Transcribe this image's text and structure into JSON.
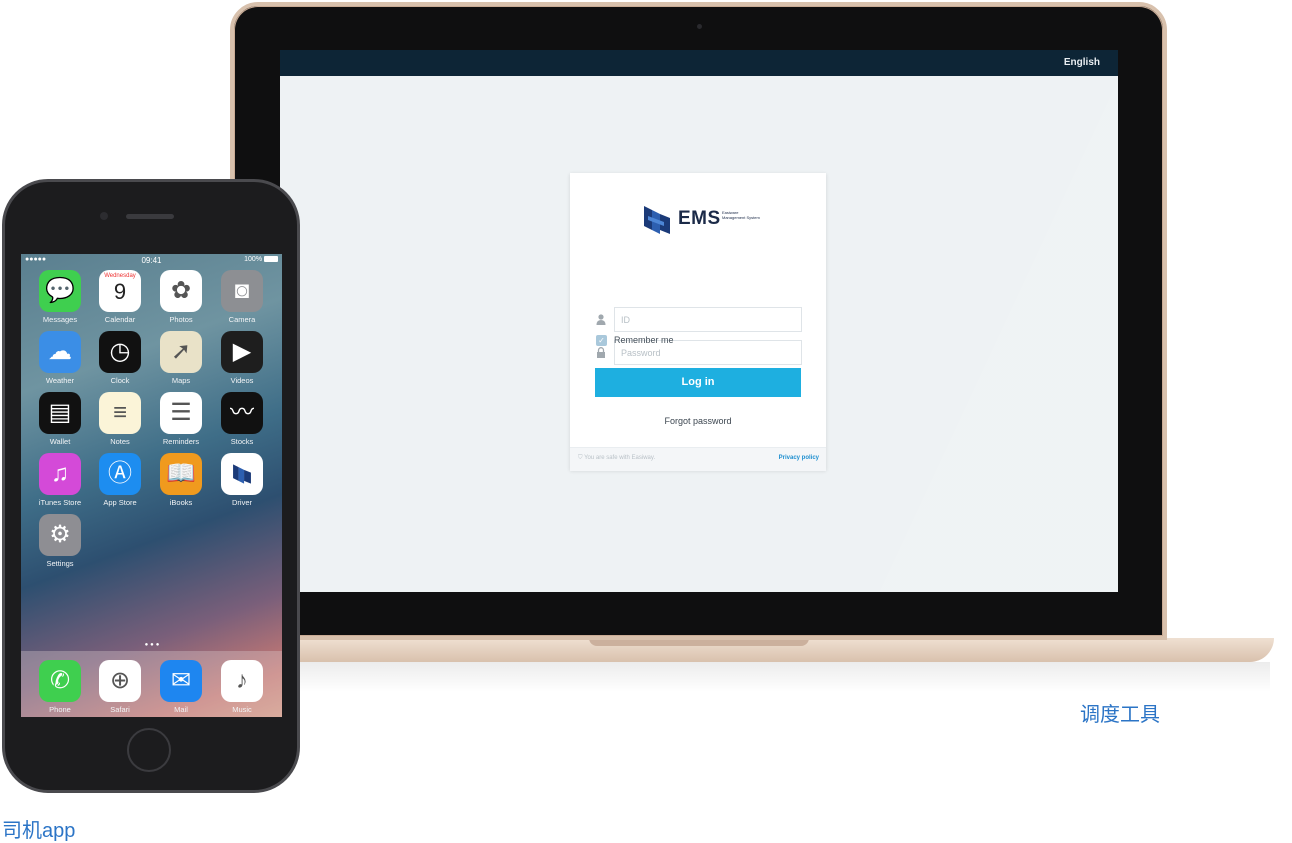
{
  "laptop": {
    "header": {
      "language": "English"
    },
    "login_card": {
      "logo": {
        "name": "EMS",
        "subtitle": "Easiware Management System"
      },
      "id_field": {
        "placeholder": "ID"
      },
      "password_field": {
        "placeholder": "Password"
      },
      "remember_label": "Remember me",
      "login_button": "Log in",
      "forgot_link": "Forgot password",
      "footer": {
        "safe_text": "You are safe with Easiway.",
        "privacy_link": "Privacy policy"
      }
    },
    "caption": "调度工具"
  },
  "phone": {
    "status_bar": {
      "carrier": "●●●●● ",
      "time": "09:41",
      "battery": "100%"
    },
    "calendar_day": "Wednesday",
    "calendar_date": "9",
    "apps": [
      {
        "label": "Messages",
        "icon": "messages-icon",
        "color": "#3fcf4f",
        "glyph": "💬"
      },
      {
        "label": "Calendar",
        "icon": "calendar-icon",
        "color": "#ffffff",
        "glyph": ""
      },
      {
        "label": "Photos",
        "icon": "photos-icon",
        "color": "#ffffff",
        "glyph": "✿"
      },
      {
        "label": "Camera",
        "icon": "camera-icon",
        "color": "#8d8f93",
        "glyph": "◙"
      },
      {
        "label": "Weather",
        "icon": "weather-icon",
        "color": "#3b8ee6",
        "glyph": "☁"
      },
      {
        "label": "Clock",
        "icon": "clock-icon",
        "color": "#111111",
        "glyph": "◷"
      },
      {
        "label": "Maps",
        "icon": "maps-icon",
        "color": "#e9e2c8",
        "glyph": "➚"
      },
      {
        "label": "Videos",
        "icon": "videos-icon",
        "color": "#1e1e1e",
        "glyph": "▶"
      },
      {
        "label": "Wallet",
        "icon": "wallet-icon",
        "color": "#111111",
        "glyph": "▤"
      },
      {
        "label": "Notes",
        "icon": "notes-icon",
        "color": "#fbf4d8",
        "glyph": "≡"
      },
      {
        "label": "Reminders",
        "icon": "reminders-icon",
        "color": "#ffffff",
        "glyph": "☰"
      },
      {
        "label": "Stocks",
        "icon": "stocks-icon",
        "color": "#111111",
        "glyph": "〰"
      },
      {
        "label": "iTunes Store",
        "icon": "itunes-store-icon",
        "color": "#d44ad8",
        "glyph": "♫"
      },
      {
        "label": "App Store",
        "icon": "app-store-icon",
        "color": "#1d8df0",
        "glyph": "Ⓐ"
      },
      {
        "label": "iBooks",
        "icon": "ibooks-icon",
        "color": "#f09a1e",
        "glyph": "📖"
      },
      {
        "label": "Driver",
        "icon": "driver-app-icon",
        "color": "#ffffff",
        "glyph": ""
      },
      {
        "label": "Settings",
        "icon": "settings-icon",
        "color": "#8e8e93",
        "glyph": "⚙"
      }
    ],
    "dock": [
      {
        "label": "Phone",
        "icon": "phone-icon",
        "color": "#3fcf4f",
        "glyph": "✆"
      },
      {
        "label": "Safari",
        "icon": "safari-icon",
        "color": "#ffffff",
        "glyph": "⊕"
      },
      {
        "label": "Mail",
        "icon": "mail-icon",
        "color": "#1e86f0",
        "glyph": "✉"
      },
      {
        "label": "Music",
        "icon": "music-icon",
        "color": "#ffffff",
        "glyph": "♪"
      }
    ],
    "caption": "司机app"
  }
}
